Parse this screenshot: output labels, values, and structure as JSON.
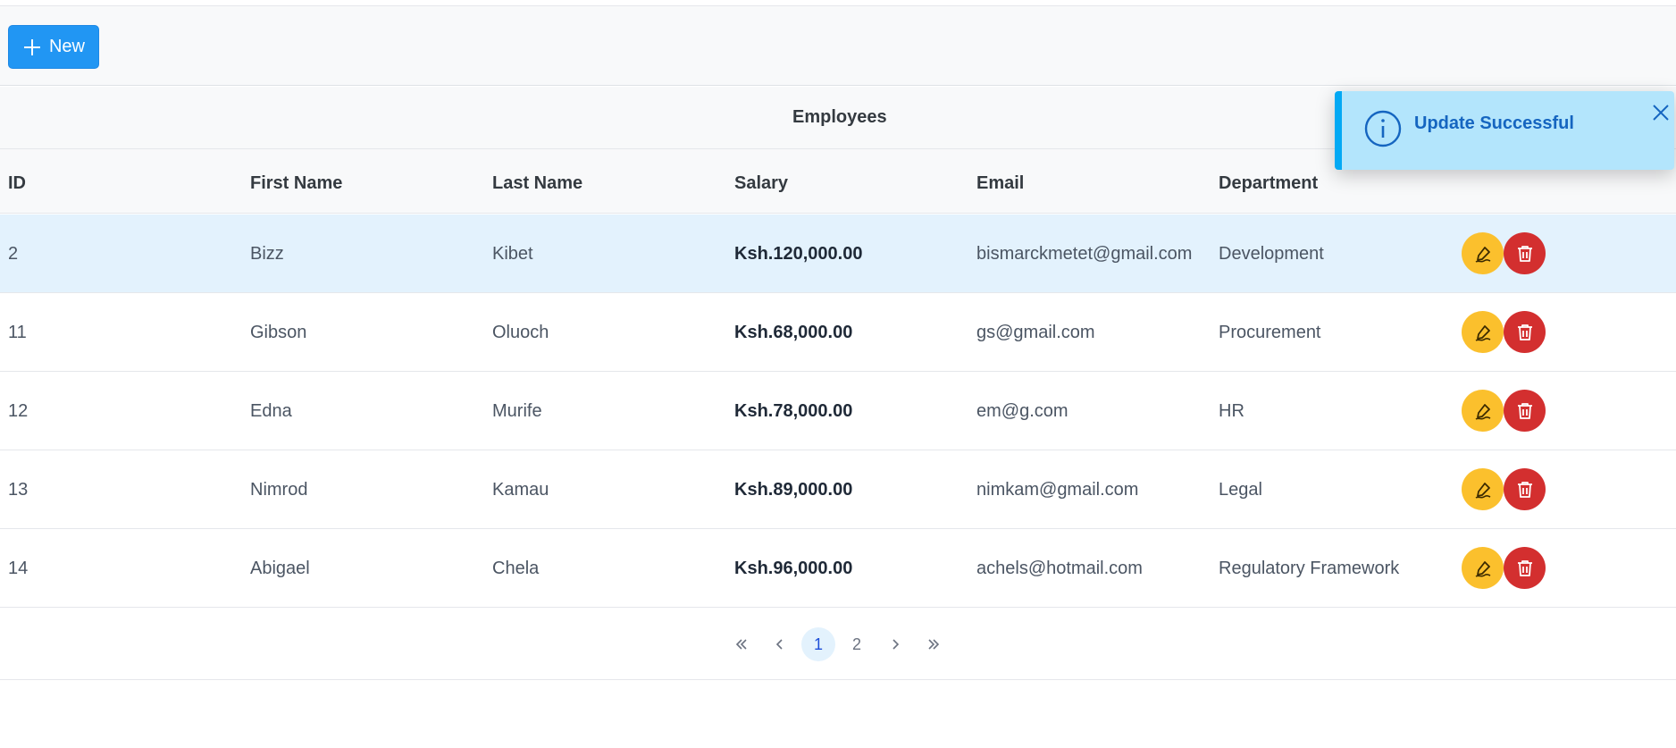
{
  "toolbar": {
    "new_label": "New"
  },
  "table": {
    "caption": "Employees",
    "columns": [
      "ID",
      "First Name",
      "Last Name",
      "Salary",
      "Email",
      "Department"
    ],
    "rows": [
      {
        "id": "2",
        "first_name": "Bizz",
        "last_name": "Kibet",
        "salary": "Ksh.120,000.00",
        "email": "bismarckmetet@gmail.com",
        "department": "Development"
      },
      {
        "id": "11",
        "first_name": "Gibson",
        "last_name": "Oluoch",
        "salary": "Ksh.68,000.00",
        "email": "gs@gmail.com",
        "department": "Procurement"
      },
      {
        "id": "12",
        "first_name": "Edna",
        "last_name": "Murife",
        "salary": "Ksh.78,000.00",
        "email": "em@g.com",
        "department": "HR"
      },
      {
        "id": "13",
        "first_name": "Nimrod",
        "last_name": "Kamau",
        "salary": "Ksh.89,000.00",
        "email": "nimkam@gmail.com",
        "department": "Legal"
      },
      {
        "id": "14",
        "first_name": "Abigael",
        "last_name": "Chela",
        "salary": "Ksh.96,000.00",
        "email": "achels@hotmail.com",
        "department": "Regulatory Framework"
      }
    ]
  },
  "paginator": {
    "pages": [
      "1",
      "2"
    ],
    "current": "1"
  },
  "toast": {
    "message": "Update Successful"
  },
  "colors": {
    "primary": "#2196f3",
    "edit": "#fbc02d",
    "delete": "#d32f2f",
    "selected_row": "#e3f2fd",
    "toast_bg": "#b3e5fc",
    "toast_accent": "#03a9f4"
  }
}
